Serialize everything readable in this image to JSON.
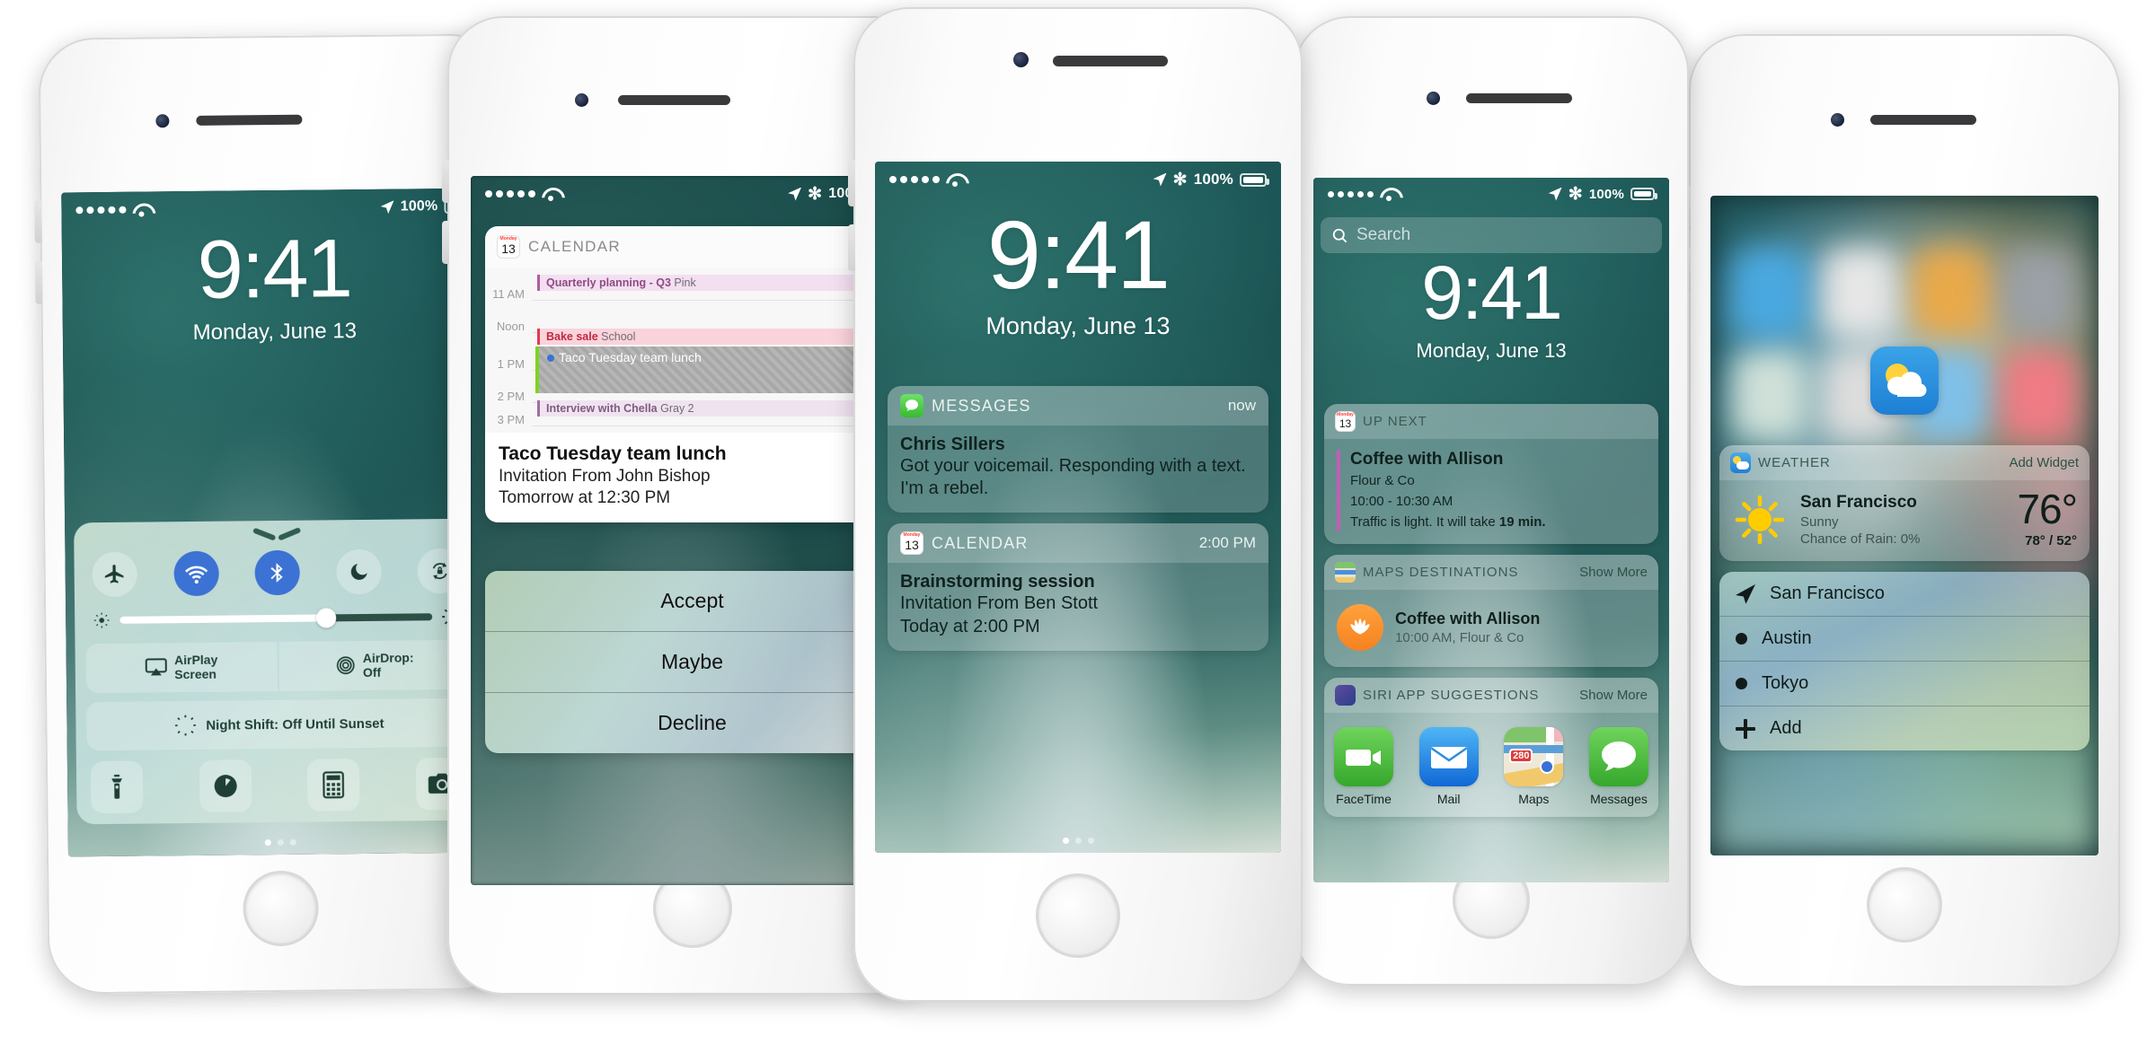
{
  "common": {
    "status": {
      "carrier_dots": 5,
      "wifi_icon": "wifi-icon",
      "location_icon": "location-arrow-icon",
      "bluetooth_icon": "bluetooth-icon",
      "battery_pct": "100%"
    },
    "lock_time": "9:41",
    "lock_date": "Monday, June 13"
  },
  "phone1": {
    "name": "lock-screen-control-center",
    "control_center": {
      "toggles": [
        {
          "icon": "airplane-icon",
          "label": "Airplane Mode",
          "on": false
        },
        {
          "icon": "wifi-icon",
          "label": "Wi-Fi",
          "on": true
        },
        {
          "icon": "bluetooth-icon",
          "label": "Bluetooth",
          "on": true
        },
        {
          "icon": "moon-icon",
          "label": "Do Not Disturb",
          "on": false
        },
        {
          "icon": "rotation-lock-icon",
          "label": "Rotation Lock",
          "on": false
        }
      ],
      "brightness": {
        "icon_low": "brightness-low-icon",
        "icon_high": "brightness-high-icon",
        "value": 66
      },
      "airplay": {
        "icon": "airplay-icon",
        "line1": "AirPlay",
        "line2": "Screen"
      },
      "airdrop": {
        "icon": "airdrop-icon",
        "line1": "AirDrop:",
        "line2": "Off"
      },
      "night_shift": {
        "icon": "night-shift-icon",
        "label": "Night Shift: Off Until Sunset"
      },
      "apps": [
        {
          "icon": "flashlight-icon",
          "label": "Flashlight"
        },
        {
          "icon": "timer-icon",
          "label": "Timer"
        },
        {
          "icon": "calculator-icon",
          "label": "Calculator"
        },
        {
          "icon": "camera-icon",
          "label": "Camera"
        }
      ]
    },
    "page_dots": {
      "count": 3,
      "active": 1
    }
  },
  "phone2": {
    "name": "calendar-invitation-3d-touch",
    "notification": {
      "app_icon": "calendar-icon",
      "app_icon_day": "13",
      "app_icon_month": "Monday",
      "app_name": "CALENDAR",
      "close_icon": "close-icon",
      "agenda": {
        "hours": [
          "11 AM",
          "Noon",
          "1 PM",
          "2 PM",
          "3 PM"
        ],
        "events": [
          {
            "title": "Quarterly planning - Q3",
            "calendar": "Pink",
            "color": "pink"
          },
          {
            "title": "Bake sale",
            "calendar": "School",
            "color": "red"
          },
          {
            "title": "Taco Tuesday team lunch",
            "calendar": "",
            "color": "selected"
          },
          {
            "title": "Interview with Chella",
            "calendar": "Gray 2",
            "color": "gray"
          }
        ]
      },
      "title": "Taco Tuesday team lunch",
      "subtitle": "Invitation From John Bishop",
      "when": "Tomorrow at 12:30 PM"
    },
    "actions": [
      "Accept",
      "Maybe",
      "Decline"
    ]
  },
  "phone3": {
    "name": "lock-screen-notifications",
    "notifications": [
      {
        "app_icon": "messages-icon",
        "app_name": "MESSAGES",
        "time": "now",
        "title": "Chris Sillers",
        "body": "Got your voicemail. Responding with a text. I'm a rebel."
      },
      {
        "app_icon": "calendar-icon",
        "app_icon_day": "13",
        "app_icon_month": "Monday",
        "app_name": "CALENDAR",
        "time": "2:00 PM",
        "title": "Brainstorming session",
        "body": "Invitation From Ben Stott",
        "body2": "Today at 2:00 PM"
      }
    ],
    "page_dots": {
      "count": 3,
      "active": 1
    }
  },
  "phone4": {
    "name": "today-view-widgets",
    "search": {
      "icon": "search-icon",
      "placeholder": "Search"
    },
    "widgets": [
      {
        "icon": "calendar-icon",
        "icon_day": "13",
        "icon_month": "Monday",
        "title": "UP NEXT",
        "action": "",
        "event_title": "Coffee with Allison",
        "event_place": "Flour & Co",
        "event_time": "10:00 - 10:30 AM",
        "event_traffic_prefix": "Traffic is light. It will take ",
        "event_traffic_bold": "19 min."
      },
      {
        "icon": "maps-icon",
        "title": "MAPS DESTINATIONS",
        "action": "Show More",
        "dest_icon": "croissant-icon",
        "dest_title": "Coffee with Allison",
        "dest_sub": "10:00 AM, Flour & Co"
      },
      {
        "icon": "siri-icon",
        "title": "SIRI APP SUGGESTIONS",
        "action": "Show More",
        "apps": [
          {
            "icon": "facetime-icon",
            "label": "FaceTime"
          },
          {
            "icon": "mail-icon",
            "label": "Mail"
          },
          {
            "icon": "maps-icon",
            "label": "Maps",
            "badge": "280"
          },
          {
            "icon": "messages-icon",
            "label": "Messages"
          }
        ]
      }
    ]
  },
  "phone5": {
    "name": "weather-widget-home-screen",
    "app_icon": "weather-app-icon",
    "widget": {
      "icon": "weather-icon",
      "title": "WEATHER",
      "action": "Add Widget",
      "condition_icon": "sun-icon",
      "city": "San Francisco",
      "condition": "Sunny",
      "rain": "Chance of Rain: 0%",
      "temp": "76°",
      "hilo": "78° / 52°"
    },
    "cities": [
      {
        "icon": "location-arrow-icon",
        "name": "San Francisco"
      },
      {
        "icon": "bullet-icon",
        "name": "Austin"
      },
      {
        "icon": "bullet-icon",
        "name": "Tokyo"
      },
      {
        "icon": "plus-icon",
        "name": "Add"
      }
    ]
  }
}
